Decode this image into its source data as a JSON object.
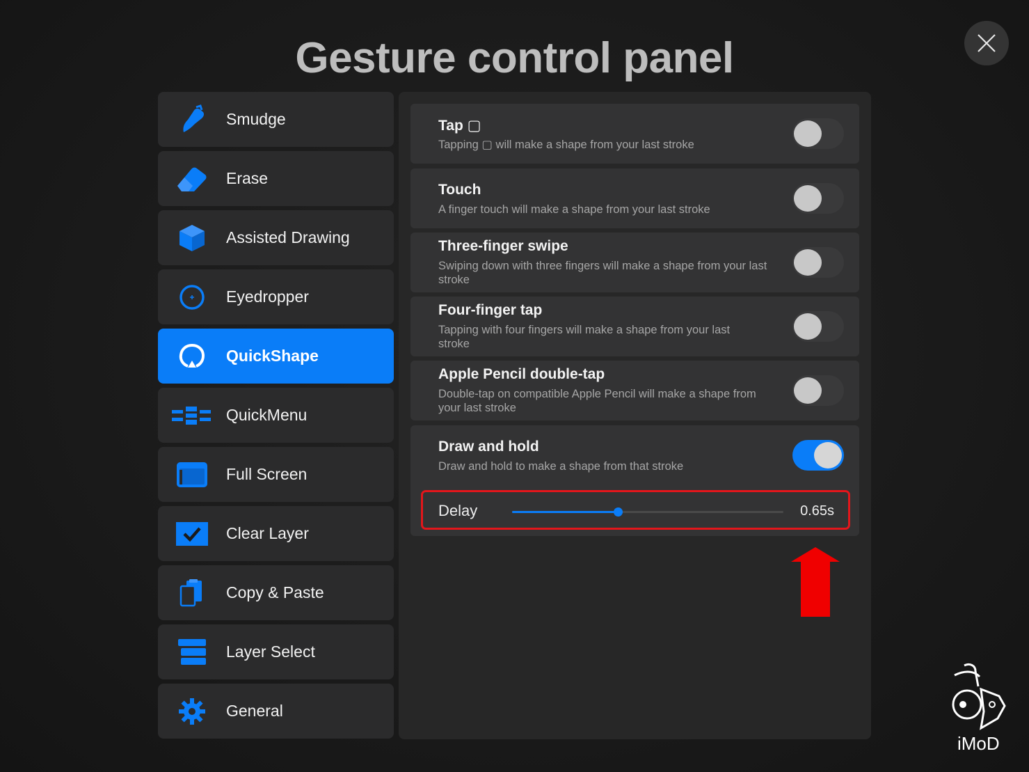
{
  "title": "Gesture control panel",
  "sidebar": {
    "items": [
      {
        "label": "Smudge",
        "icon": "smudge-icon"
      },
      {
        "label": "Erase",
        "icon": "eraser-icon"
      },
      {
        "label": "Assisted Drawing",
        "icon": "cube-icon"
      },
      {
        "label": "Eyedropper",
        "icon": "eyedropper-icon"
      },
      {
        "label": "QuickShape",
        "icon": "quickshape-icon",
        "active": true
      },
      {
        "label": "QuickMenu",
        "icon": "quickmenu-icon"
      },
      {
        "label": "Full Screen",
        "icon": "fullscreen-icon"
      },
      {
        "label": "Clear Layer",
        "icon": "clear-layer-icon"
      },
      {
        "label": "Copy & Paste",
        "icon": "copy-paste-icon"
      },
      {
        "label": "Layer Select",
        "icon": "layer-select-icon"
      },
      {
        "label": "General",
        "icon": "gear-icon"
      }
    ]
  },
  "settings": [
    {
      "title": "Tap ▢",
      "desc": "Tapping ▢ will make a shape from your last stroke",
      "on": false
    },
    {
      "title": "Touch",
      "desc": "A finger touch will make a shape from your last stroke",
      "on": false
    },
    {
      "title": "Three-finger swipe",
      "desc": "Swiping down with three fingers will make a shape from your last stroke",
      "on": false
    },
    {
      "title": "Four-finger tap",
      "desc": "Tapping with four fingers will make a shape from your last stroke",
      "on": false
    },
    {
      "title": "Apple Pencil double-tap",
      "desc": "Double-tap on compatible Apple Pencil will make a shape from your last stroke",
      "on": false
    },
    {
      "title": "Draw and hold",
      "desc": "Draw and hold to make a shape from that stroke",
      "on": true
    }
  ],
  "delay": {
    "label": "Delay",
    "value_text": "0.65s",
    "fraction": 0.39
  },
  "watermark": "iMoD",
  "colors": {
    "accent": "#0a7df8",
    "highlight_border": "#e3161b",
    "arrow": "#f00000"
  }
}
